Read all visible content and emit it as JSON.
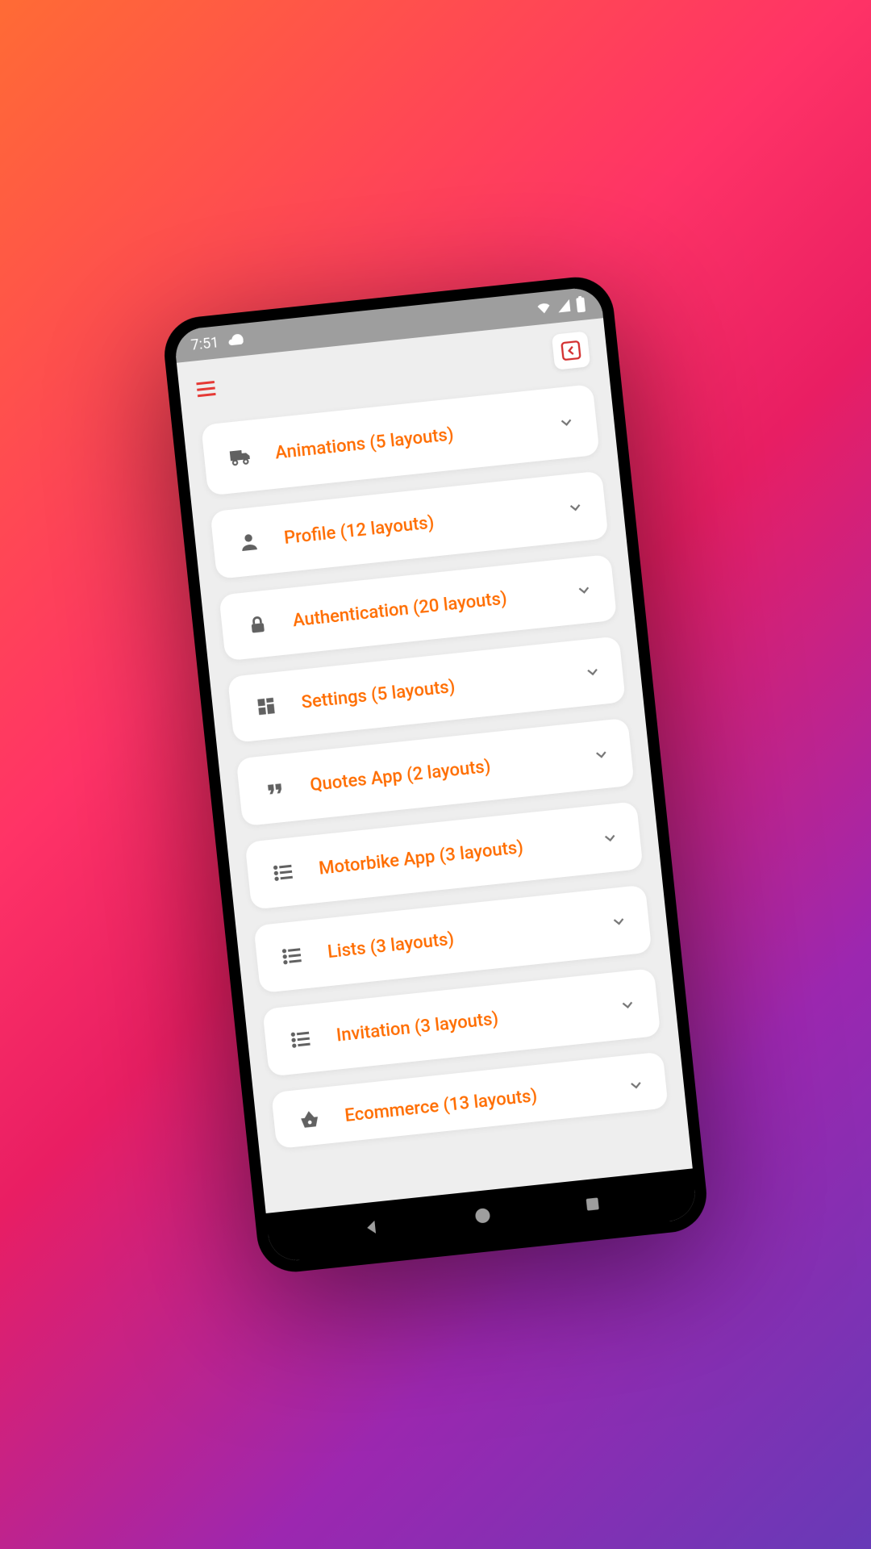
{
  "statusbar": {
    "time": "7:51"
  },
  "menu": {
    "items": [
      {
        "label": "Animations (5 layouts)",
        "icon": "truck"
      },
      {
        "label": "Profile (12 layouts)",
        "icon": "person"
      },
      {
        "label": "Authentication (20 layouts)",
        "icon": "lock"
      },
      {
        "label": "Settings (5 layouts)",
        "icon": "dashboard"
      },
      {
        "label": "Quotes App (2 layouts)",
        "icon": "quote"
      },
      {
        "label": "Motorbike App (3 layouts)",
        "icon": "list"
      },
      {
        "label": "Lists (3 layouts)",
        "icon": "list"
      },
      {
        "label": "Invitation (3 layouts)",
        "icon": "list"
      },
      {
        "label": "Ecommerce (13 layouts)",
        "icon": "basket"
      }
    ]
  }
}
